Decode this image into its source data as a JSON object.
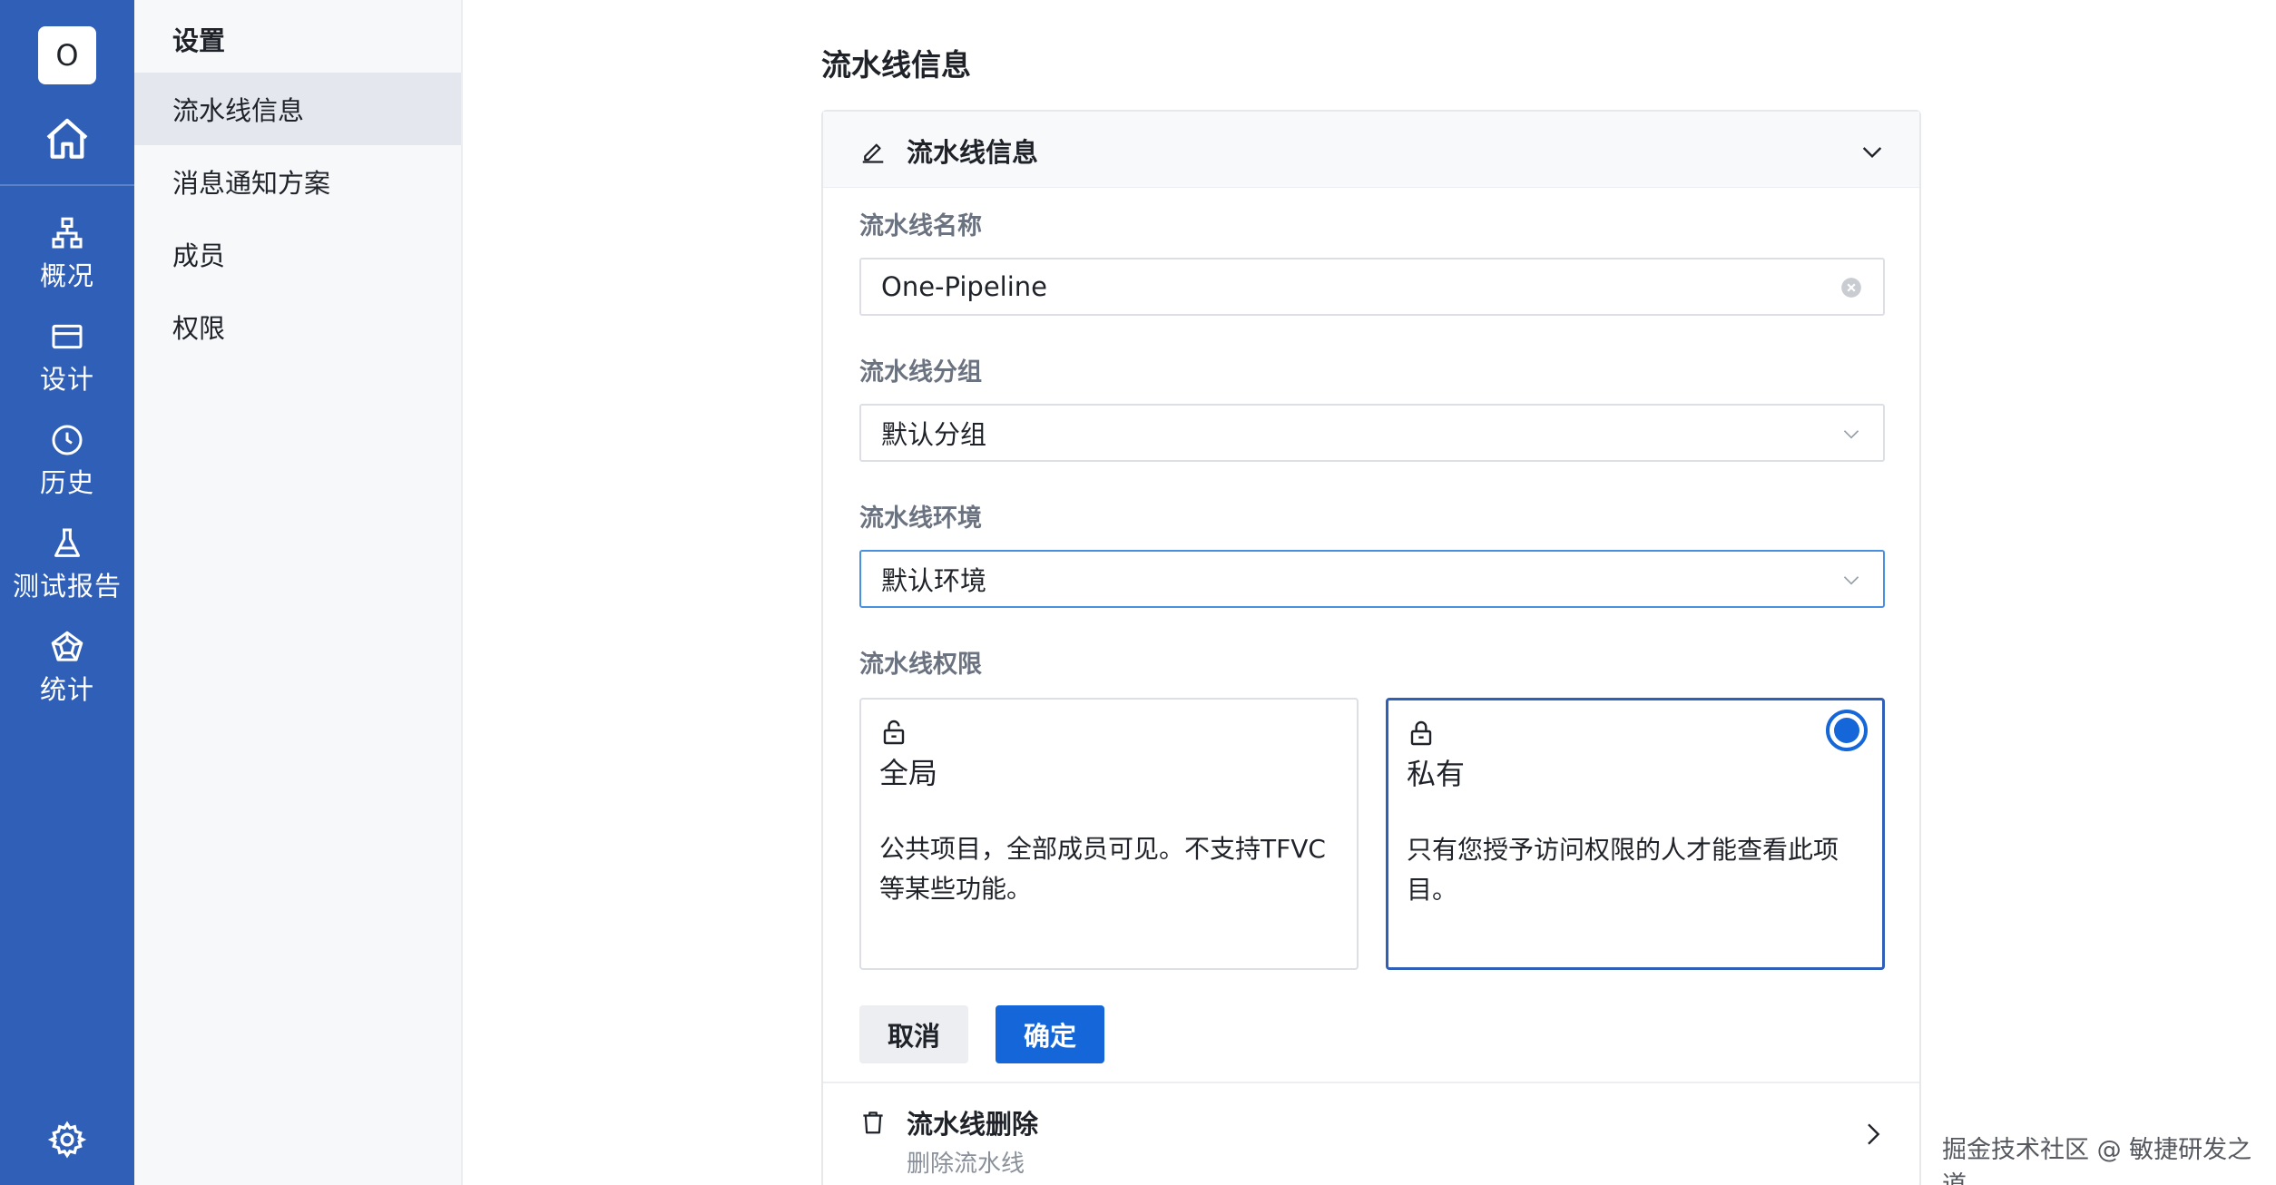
{
  "rail": {
    "avatar_letter": "O",
    "items": [
      {
        "label": "概况",
        "icon": "sitemap-icon"
      },
      {
        "label": "设计",
        "icon": "card-icon"
      },
      {
        "label": "历史",
        "icon": "clock-icon"
      },
      {
        "label": "测试报告",
        "icon": "flask-icon"
      },
      {
        "label": "统计",
        "icon": "pentagon-icon"
      }
    ]
  },
  "menu": {
    "title": "设置",
    "items": [
      {
        "label": "流水线信息",
        "active": true
      },
      {
        "label": "消息通知方案",
        "active": false
      },
      {
        "label": "成员",
        "active": false
      },
      {
        "label": "权限",
        "active": false
      }
    ]
  },
  "main": {
    "title": "流水线信息",
    "card_title": "流水线信息",
    "fields": {
      "name": {
        "label": "流水线名称",
        "value": "One-Pipeline"
      },
      "group": {
        "label": "流水线分组",
        "value": "默认分组"
      },
      "env": {
        "label": "流水线环境",
        "value": "默认环境"
      },
      "permission_label": "流水线权限"
    },
    "permissions": [
      {
        "title": "全局",
        "desc": "公共项目，全部成员可见。不支持TFVC等某些功能。",
        "selected": false
      },
      {
        "title": "私有",
        "desc": "只有您授予访问权限的人才能查看此项目。",
        "selected": true
      }
    ],
    "cancel_label": "取消",
    "ok_label": "确定",
    "delete": {
      "title": "流水线删除",
      "subtitle": "删除流水线"
    }
  },
  "watermark": "掘金技术社区 @ 敏捷研发之道",
  "colors": {
    "rail": "#2f5fb6",
    "primary": "#1466d9"
  }
}
